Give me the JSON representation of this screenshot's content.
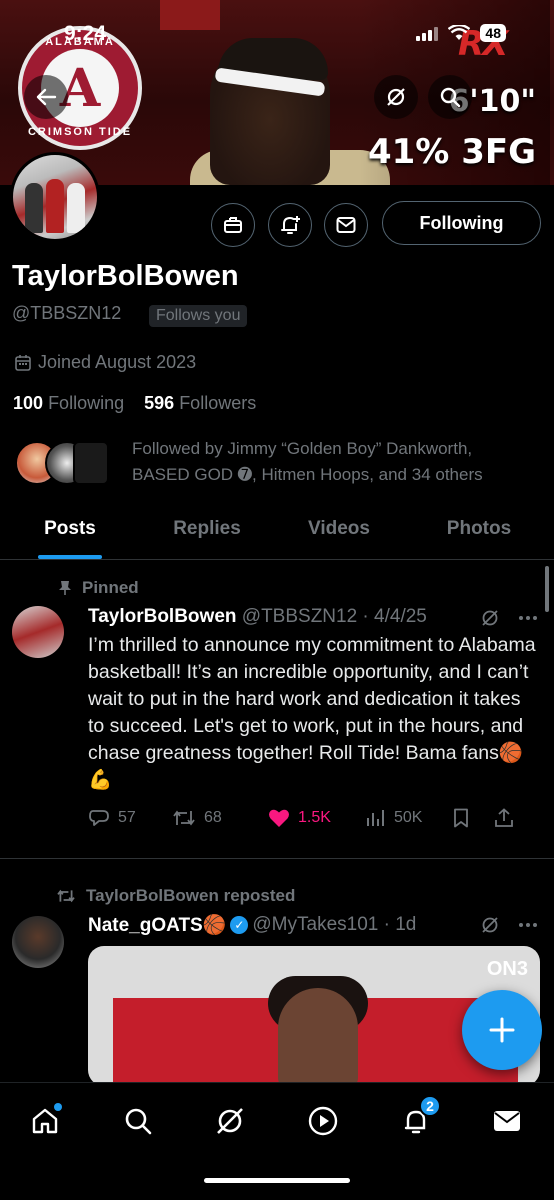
{
  "status_bar": {
    "time": "9:24",
    "battery": "48"
  },
  "banner": {
    "logo_top": "ALABAMA",
    "logo_bottom": "CRIMSON TIDE",
    "logo_letter": "A",
    "badge": "RX",
    "stat_height": "6'10\"",
    "stat_3fg": "41% 3FG"
  },
  "profile": {
    "display_name": "TaylorBolBowen",
    "handle": "@TBBSZN12",
    "follows_you": "Follows you",
    "joined": "Joined August 2023",
    "following_count": "100",
    "following_label": "Following",
    "followers_count": "596",
    "followers_label": "Followers",
    "followed_by": "Followed by Jimmy “Golden Boy” Dankworth, BASED GOD ➐, Hitmen Hoops, and 34 others",
    "follow_button": "Following"
  },
  "tabs": [
    "Posts",
    "Replies",
    "Videos",
    "Photos"
  ],
  "posts": [
    {
      "context": "Pinned",
      "name": "TaylorBolBowen",
      "meta": "@TBBSZN12 · 4/4/25",
      "text": "I’m thrilled to announce my commitment to Alabama basketball! It’s an incredible opportunity, and I can’t wait to put in the hard work and dedication it takes to succeed. Let's get to work, put in the hours, and chase greatness together! Roll Tide! Bama fans🏀💪",
      "replies": "57",
      "reposts": "68",
      "likes": "1.5K",
      "views": "50K"
    },
    {
      "context": "TaylorBolBowen reposted",
      "name": "Nate_gOATS🏀",
      "meta": "@MyTakes101 · 1d",
      "media_badge": "ON3"
    }
  ],
  "nav": {
    "notif_count": "2"
  },
  "colors": {
    "accent": "#1d9bf0",
    "like": "#f91880",
    "muted": "#71767b",
    "crimson": "#9e1b32"
  }
}
